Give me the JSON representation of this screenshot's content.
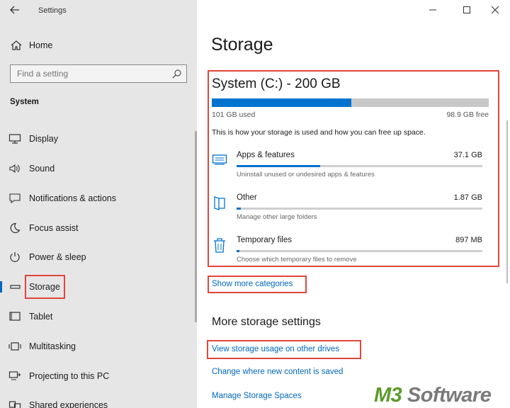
{
  "window": {
    "title": "Settings",
    "back_icon": "arrow-left-icon",
    "controls": [
      "minimize-icon",
      "maximize-icon",
      "close-icon"
    ]
  },
  "sidebar": {
    "home": {
      "label": "Home",
      "icon": "home-icon"
    },
    "search": {
      "placeholder": "Find a setting",
      "icon": "search-icon"
    },
    "section": "System",
    "items": [
      {
        "label": "Display",
        "icon": "display-icon",
        "active": false
      },
      {
        "label": "Sound",
        "icon": "sound-icon",
        "active": false
      },
      {
        "label": "Notifications & actions",
        "icon": "notifications-icon",
        "active": false
      },
      {
        "label": "Focus assist",
        "icon": "moon-icon",
        "active": false
      },
      {
        "label": "Power & sleep",
        "icon": "power-icon",
        "active": false
      },
      {
        "label": "Storage",
        "icon": "storage-icon",
        "active": true
      },
      {
        "label": "Tablet",
        "icon": "tablet-icon",
        "active": false
      },
      {
        "label": "Multitasking",
        "icon": "multitasking-icon",
        "active": false
      },
      {
        "label": "Projecting to this PC",
        "icon": "projecting-icon",
        "active": false
      },
      {
        "label": "Shared experiences",
        "icon": "shared-icon",
        "active": false
      }
    ]
  },
  "main": {
    "title": "Storage",
    "drive": {
      "title": "System (C:) - 200 GB",
      "used_fraction": 0.505,
      "used": "101 GB used",
      "free": "98.9 GB free",
      "explanation": "This is how your storage is used and how you can free up space."
    },
    "categories": [
      {
        "name": "Apps & features",
        "size": "37.1 GB",
        "fraction": 0.34,
        "description": "Uninstall unused or undesired apps & features",
        "icon": "apps-icon"
      },
      {
        "name": "Other",
        "size": "1.87 GB",
        "fraction": 0.018,
        "description": "Manage other large folders",
        "icon": "folder-icon"
      },
      {
        "name": "Temporary files",
        "size": "897 MB",
        "fraction": 0.008,
        "description": "Choose which temporary files to remove",
        "icon": "trash-icon"
      }
    ],
    "show_more": "Show more categories",
    "more_settings": {
      "title": "More storage settings",
      "links": [
        "View storage usage on other drives",
        "Change where new content is saved",
        "Manage Storage Spaces"
      ]
    }
  },
  "watermark": {
    "prefix": "M3",
    "suffix": " Software"
  },
  "colors": {
    "accent": "#0073cf",
    "highlight": "#e0463c",
    "link": "#0067c0",
    "sidebar_bg": "#e6e6e6"
  }
}
